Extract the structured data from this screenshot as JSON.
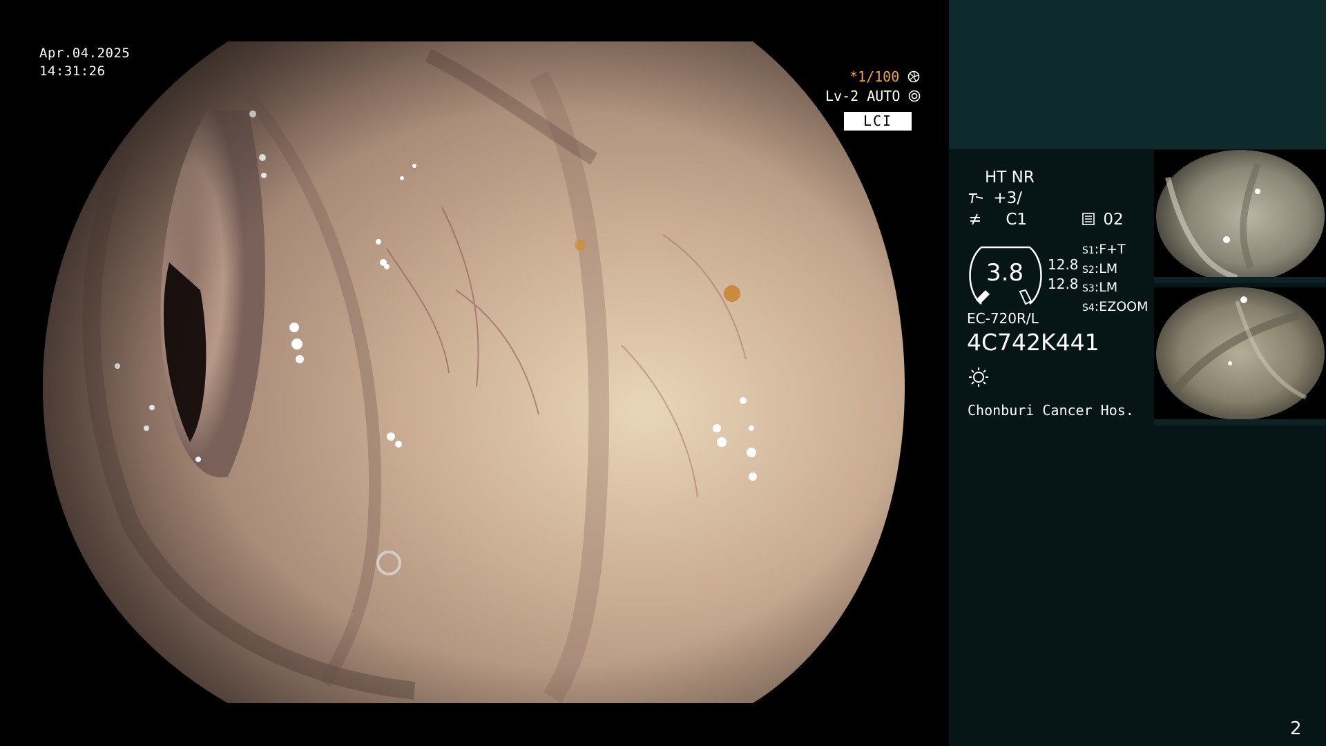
{
  "overlay": {
    "date": "Apr.04.2025",
    "time": "14:31:26",
    "shutter": "*1/100",
    "level": "Lv-2 AUTO",
    "mode": "LCI"
  },
  "panel": {
    "ht_nr": "HT NR",
    "enhance": "+3/",
    "color": "C1",
    "memo": "02",
    "zoom_value": "3.8",
    "val1": "12.8",
    "val2": "12.8",
    "switches": [
      {
        "key": "S1",
        "value": "F+T"
      },
      {
        "key": "S2",
        "value": "LM"
      },
      {
        "key": "S3",
        "value": "LM"
      },
      {
        "key": "S4",
        "value": "EZOOM"
      }
    ],
    "scope_model": "EC-720R/L",
    "serial": "4C742K441",
    "hospital": "Chonburi Cancer Hos.",
    "page": "2"
  },
  "colors": {
    "panel_bg": "#061516",
    "panel_top": "#0e2a2c",
    "shutter_text": "#f0a43a"
  },
  "icons": [
    "aperture-icon",
    "iris-icon",
    "enhance-icon",
    "color-icon",
    "memo-icon",
    "light-source-icon"
  ]
}
